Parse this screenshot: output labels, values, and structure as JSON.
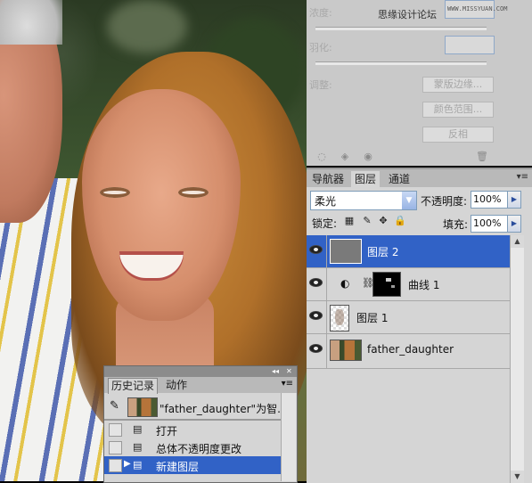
{
  "canvas": {
    "description_icon": "photo-canvas"
  },
  "masks_panel": {
    "density_label": "浓度:",
    "feather_label": "羽化:",
    "refine_label": "调整:",
    "watermark": "思缘设计论坛",
    "watermark_url": "WWW.MISSYUAN.COM",
    "buttons": [
      "蒙版边缘...",
      "颜色范围...",
      "反相"
    ]
  },
  "layers_panel": {
    "tabs": [
      "导航器",
      "图层",
      "通道"
    ],
    "active_tab": "图层",
    "blend_mode": "柔光",
    "opacity_label": "不透明度:",
    "opacity_value": "100%",
    "lock_label": "锁定:",
    "fill_label": "填充:",
    "fill_value": "100%",
    "layers": [
      {
        "name": "图层 2",
        "selected": true,
        "thumb": "gray"
      },
      {
        "name": "曲线 1",
        "selected": false,
        "thumb": "mask"
      },
      {
        "name": "图层 1",
        "selected": false,
        "thumb": "transparent"
      },
      {
        "name": "father_daughter",
        "selected": false,
        "thumb": "photo"
      }
    ]
  },
  "history_panel": {
    "tabs": [
      "历史记录",
      "动作"
    ],
    "active_tab": "历史记录",
    "snapshot_label": "\"father_daughter\"为智...",
    "steps": [
      {
        "label": "打开",
        "selected": false
      },
      {
        "label": "总体不透明度更改",
        "selected": false
      },
      {
        "label": "新建图层",
        "selected": true
      }
    ]
  },
  "colors": {
    "selection": "#3162c6",
    "panel": "#d5d5d5"
  }
}
